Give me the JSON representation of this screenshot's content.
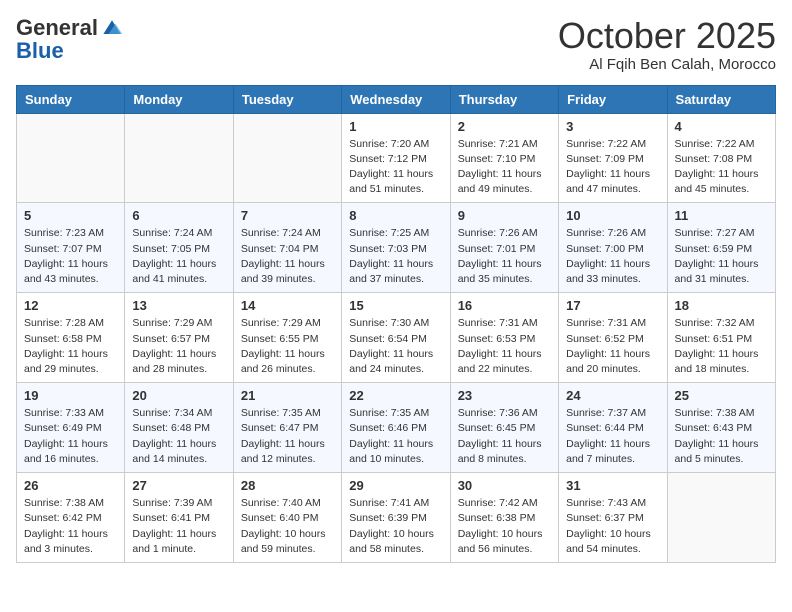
{
  "header": {
    "logo_general": "General",
    "logo_blue": "Blue",
    "month": "October 2025",
    "location": "Al Fqih Ben Calah, Morocco"
  },
  "days_of_week": [
    "Sunday",
    "Monday",
    "Tuesday",
    "Wednesday",
    "Thursday",
    "Friday",
    "Saturday"
  ],
  "weeks": [
    [
      {
        "day": "",
        "sunrise": "",
        "sunset": "",
        "daylight": ""
      },
      {
        "day": "",
        "sunrise": "",
        "sunset": "",
        "daylight": ""
      },
      {
        "day": "",
        "sunrise": "",
        "sunset": "",
        "daylight": ""
      },
      {
        "day": "1",
        "sunrise": "Sunrise: 7:20 AM",
        "sunset": "Sunset: 7:12 PM",
        "daylight": "Daylight: 11 hours and 51 minutes."
      },
      {
        "day": "2",
        "sunrise": "Sunrise: 7:21 AM",
        "sunset": "Sunset: 7:10 PM",
        "daylight": "Daylight: 11 hours and 49 minutes."
      },
      {
        "day": "3",
        "sunrise": "Sunrise: 7:22 AM",
        "sunset": "Sunset: 7:09 PM",
        "daylight": "Daylight: 11 hours and 47 minutes."
      },
      {
        "day": "4",
        "sunrise": "Sunrise: 7:22 AM",
        "sunset": "Sunset: 7:08 PM",
        "daylight": "Daylight: 11 hours and 45 minutes."
      }
    ],
    [
      {
        "day": "5",
        "sunrise": "Sunrise: 7:23 AM",
        "sunset": "Sunset: 7:07 PM",
        "daylight": "Daylight: 11 hours and 43 minutes."
      },
      {
        "day": "6",
        "sunrise": "Sunrise: 7:24 AM",
        "sunset": "Sunset: 7:05 PM",
        "daylight": "Daylight: 11 hours and 41 minutes."
      },
      {
        "day": "7",
        "sunrise": "Sunrise: 7:24 AM",
        "sunset": "Sunset: 7:04 PM",
        "daylight": "Daylight: 11 hours and 39 minutes."
      },
      {
        "day": "8",
        "sunrise": "Sunrise: 7:25 AM",
        "sunset": "Sunset: 7:03 PM",
        "daylight": "Daylight: 11 hours and 37 minutes."
      },
      {
        "day": "9",
        "sunrise": "Sunrise: 7:26 AM",
        "sunset": "Sunset: 7:01 PM",
        "daylight": "Daylight: 11 hours and 35 minutes."
      },
      {
        "day": "10",
        "sunrise": "Sunrise: 7:26 AM",
        "sunset": "Sunset: 7:00 PM",
        "daylight": "Daylight: 11 hours and 33 minutes."
      },
      {
        "day": "11",
        "sunrise": "Sunrise: 7:27 AM",
        "sunset": "Sunset: 6:59 PM",
        "daylight": "Daylight: 11 hours and 31 minutes."
      }
    ],
    [
      {
        "day": "12",
        "sunrise": "Sunrise: 7:28 AM",
        "sunset": "Sunset: 6:58 PM",
        "daylight": "Daylight: 11 hours and 29 minutes."
      },
      {
        "day": "13",
        "sunrise": "Sunrise: 7:29 AM",
        "sunset": "Sunset: 6:57 PM",
        "daylight": "Daylight: 11 hours and 28 minutes."
      },
      {
        "day": "14",
        "sunrise": "Sunrise: 7:29 AM",
        "sunset": "Sunset: 6:55 PM",
        "daylight": "Daylight: 11 hours and 26 minutes."
      },
      {
        "day": "15",
        "sunrise": "Sunrise: 7:30 AM",
        "sunset": "Sunset: 6:54 PM",
        "daylight": "Daylight: 11 hours and 24 minutes."
      },
      {
        "day": "16",
        "sunrise": "Sunrise: 7:31 AM",
        "sunset": "Sunset: 6:53 PM",
        "daylight": "Daylight: 11 hours and 22 minutes."
      },
      {
        "day": "17",
        "sunrise": "Sunrise: 7:31 AM",
        "sunset": "Sunset: 6:52 PM",
        "daylight": "Daylight: 11 hours and 20 minutes."
      },
      {
        "day": "18",
        "sunrise": "Sunrise: 7:32 AM",
        "sunset": "Sunset: 6:51 PM",
        "daylight": "Daylight: 11 hours and 18 minutes."
      }
    ],
    [
      {
        "day": "19",
        "sunrise": "Sunrise: 7:33 AM",
        "sunset": "Sunset: 6:49 PM",
        "daylight": "Daylight: 11 hours and 16 minutes."
      },
      {
        "day": "20",
        "sunrise": "Sunrise: 7:34 AM",
        "sunset": "Sunset: 6:48 PM",
        "daylight": "Daylight: 11 hours and 14 minutes."
      },
      {
        "day": "21",
        "sunrise": "Sunrise: 7:35 AM",
        "sunset": "Sunset: 6:47 PM",
        "daylight": "Daylight: 11 hours and 12 minutes."
      },
      {
        "day": "22",
        "sunrise": "Sunrise: 7:35 AM",
        "sunset": "Sunset: 6:46 PM",
        "daylight": "Daylight: 11 hours and 10 minutes."
      },
      {
        "day": "23",
        "sunrise": "Sunrise: 7:36 AM",
        "sunset": "Sunset: 6:45 PM",
        "daylight": "Daylight: 11 hours and 8 minutes."
      },
      {
        "day": "24",
        "sunrise": "Sunrise: 7:37 AM",
        "sunset": "Sunset: 6:44 PM",
        "daylight": "Daylight: 11 hours and 7 minutes."
      },
      {
        "day": "25",
        "sunrise": "Sunrise: 7:38 AM",
        "sunset": "Sunset: 6:43 PM",
        "daylight": "Daylight: 11 hours and 5 minutes."
      }
    ],
    [
      {
        "day": "26",
        "sunrise": "Sunrise: 7:38 AM",
        "sunset": "Sunset: 6:42 PM",
        "daylight": "Daylight: 11 hours and 3 minutes."
      },
      {
        "day": "27",
        "sunrise": "Sunrise: 7:39 AM",
        "sunset": "Sunset: 6:41 PM",
        "daylight": "Daylight: 11 hours and 1 minute."
      },
      {
        "day": "28",
        "sunrise": "Sunrise: 7:40 AM",
        "sunset": "Sunset: 6:40 PM",
        "daylight": "Daylight: 10 hours and 59 minutes."
      },
      {
        "day": "29",
        "sunrise": "Sunrise: 7:41 AM",
        "sunset": "Sunset: 6:39 PM",
        "daylight": "Daylight: 10 hours and 58 minutes."
      },
      {
        "day": "30",
        "sunrise": "Sunrise: 7:42 AM",
        "sunset": "Sunset: 6:38 PM",
        "daylight": "Daylight: 10 hours and 56 minutes."
      },
      {
        "day": "31",
        "sunrise": "Sunrise: 7:43 AM",
        "sunset": "Sunset: 6:37 PM",
        "daylight": "Daylight: 10 hours and 54 minutes."
      },
      {
        "day": "",
        "sunrise": "",
        "sunset": "",
        "daylight": ""
      }
    ]
  ]
}
